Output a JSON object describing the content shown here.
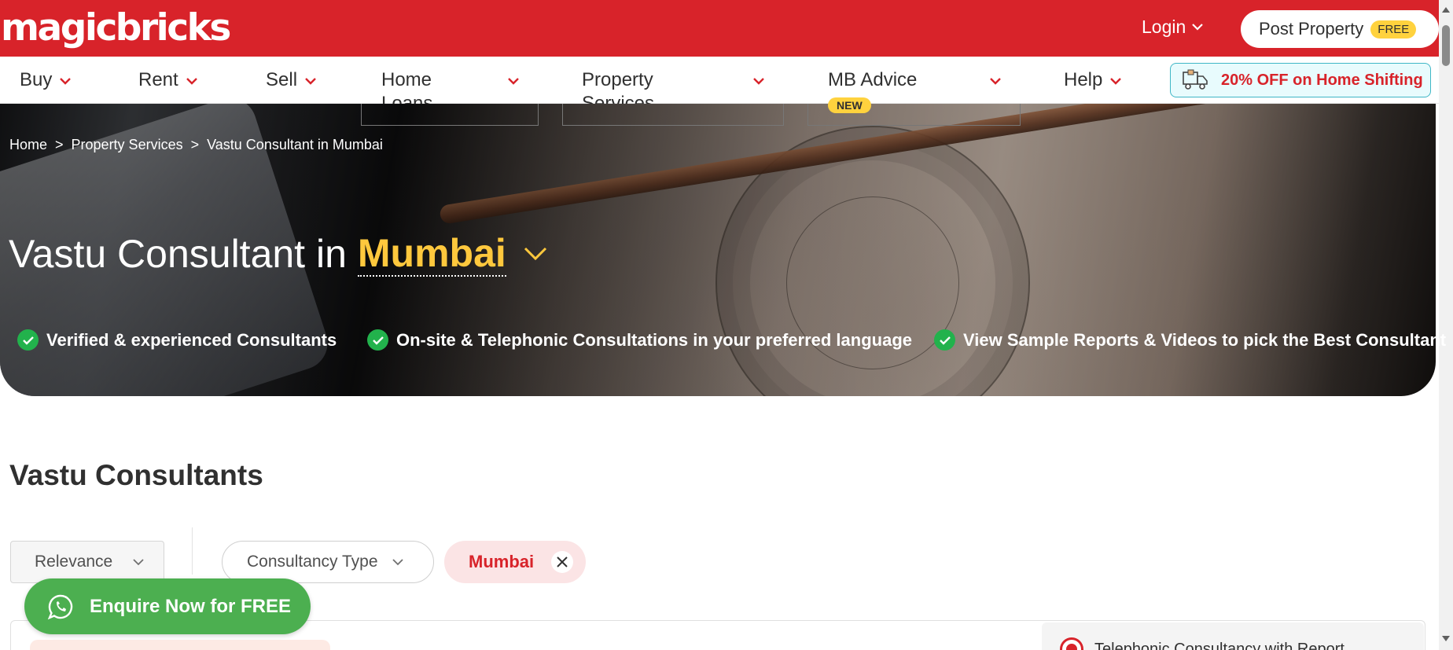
{
  "header": {
    "logo": "magicbricks",
    "login_label": "Login",
    "post_property_label": "Post Property",
    "free_badge": "FREE",
    "brand_color": "#d8232a"
  },
  "nav": {
    "items": [
      {
        "label": "Buy"
      },
      {
        "label": "Rent"
      },
      {
        "label": "Sell"
      },
      {
        "label": "Home Loans"
      },
      {
        "label": "Property Services"
      },
      {
        "label": "MB Advice"
      },
      {
        "label": "Help"
      }
    ],
    "new_badge": "NEW",
    "offer_text": "20% OFF on Home Shifting",
    "offer_icon": "truck-icon"
  },
  "breadcrumb": {
    "items": [
      "Home",
      "Property Services",
      "Vastu Consultant in Mumbai"
    ],
    "separator": ">"
  },
  "hero": {
    "title_prefix": "Vastu Consultant in",
    "city": "Mumbai",
    "city_color": "#ffc83d",
    "usps": [
      "Verified & experienced Consultants",
      "On-site & Telephonic Consultations in your preferred language",
      "View Sample Reports & Videos to pick the Best Consultant"
    ]
  },
  "listing": {
    "section_title": "Vastu Consultants",
    "sort_label": "Relevance",
    "filter_label": "Consultancy Type",
    "city_chip": "Mumbai",
    "side_option": "Telephonic Consultancy with Report"
  },
  "enquire": {
    "label": "Enquire Now for FREE",
    "icon": "whatsapp-icon",
    "color": "#4caf50"
  }
}
